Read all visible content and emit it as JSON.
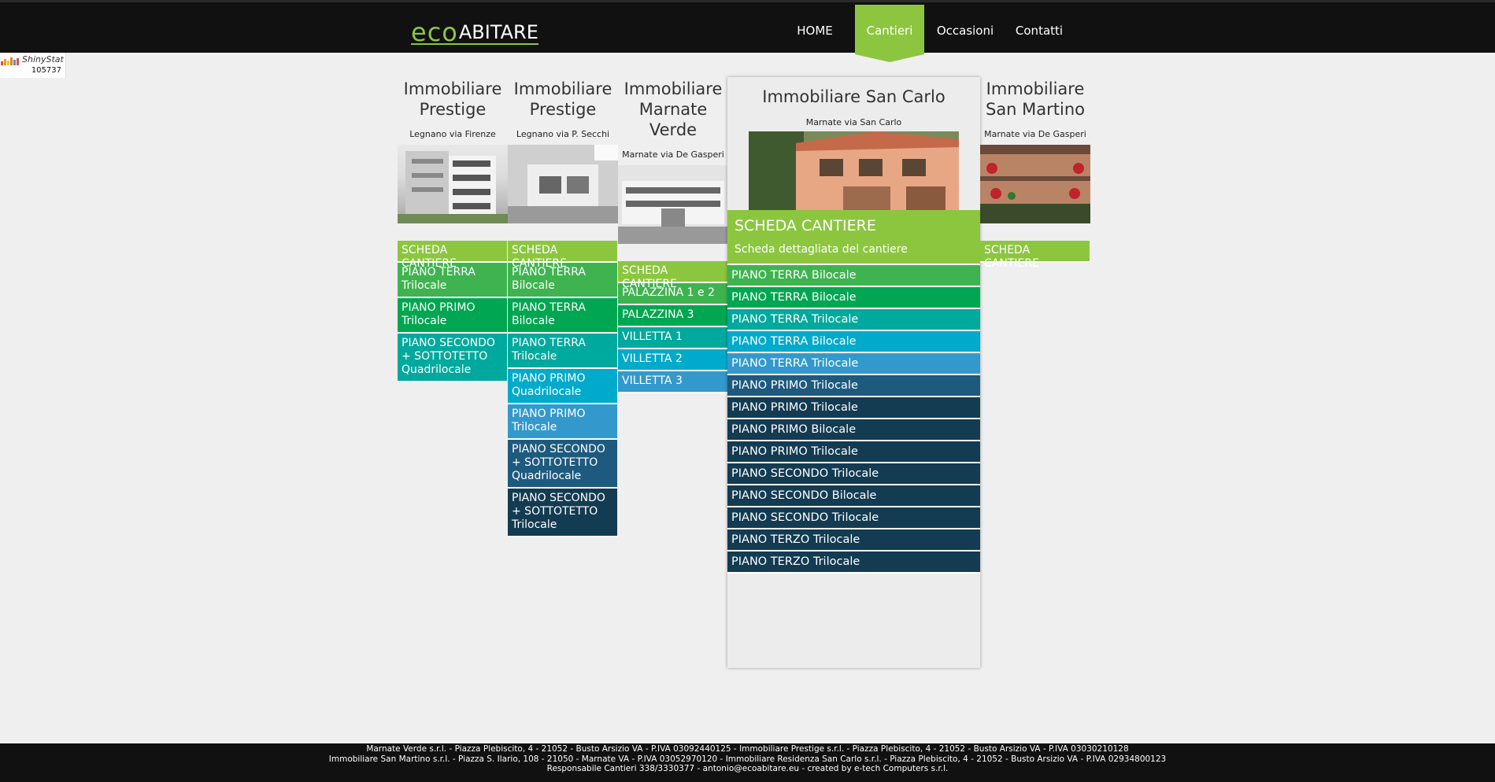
{
  "header": {
    "logo_eco": "eco",
    "logo_rest": "ABITARE",
    "nav": [
      "HOME",
      "Cantieri",
      "Occasioni",
      "Contatti"
    ],
    "active_nav": "Cantieri"
  },
  "counter": {
    "brand": "ShinyStat",
    "count": "105737"
  },
  "columns": [
    {
      "title": "Immobiliare Prestige",
      "subtitle": "Legnano via Firenze",
      "items": [
        "SCHEDA CANTIERE",
        "PIANO TERRA Trilocale",
        "PIANO PRIMO Trilocale",
        "PIANO SECONDO + SOTTOTETTO Quadrilocale"
      ]
    },
    {
      "title": "Immobiliare Prestige",
      "subtitle": "Legnano via P. Secchi",
      "items": [
        "SCHEDA CANTIERE",
        "PIANO TERRA Bilocale",
        "PIANO TERRA Bilocale",
        "PIANO TERRA Trilocale",
        "PIANO PRIMO Quadrilocale",
        "PIANO PRIMO Trilocale",
        "PIANO SECONDO + SOTTOTETTO Quadrilocale",
        "PIANO SECONDO + SOTTOTETTO Trilocale"
      ]
    },
    {
      "title": "Immobiliare Marnate Verde",
      "subtitle": "Marnate via De Gasperi",
      "items": [
        "SCHEDA CANTIERE",
        "PALAZZINA 1 e 2",
        "PALAZZINA 3",
        "VILLETTA 1",
        "VILLETTA 2",
        "VILLETTA 3"
      ]
    },
    {
      "title": "Immobiliare San Martino",
      "subtitle": "Marnate via De Gasperi",
      "items": [
        "SCHEDA CANTIERE"
      ]
    }
  ],
  "panel": {
    "title": "Immobiliare San Carlo",
    "subtitle": "Marnate via San Carlo",
    "scheda_title": "SCHEDA CANTIERE",
    "scheda_sub": "Scheda dettagliata del cantiere",
    "items": [
      "PIANO TERRA Bilocale",
      "PIANO TERRA Bilocale",
      "PIANO TERRA Trilocale",
      "PIANO TERRA Bilocale",
      "PIANO TERRA Trilocale",
      "PIANO PRIMO Trilocale",
      "PIANO PRIMO Trilocale",
      "PIANO PRIMO Bilocale",
      "PIANO PRIMO Trilocale",
      "PIANO SECONDO Trilocale",
      "PIANO SECONDO Bilocale",
      "PIANO SECONDO Trilocale",
      "PIANO TERZO Trilocale",
      "PIANO TERZO Trilocale"
    ]
  },
  "palette": [
    "#8cc63f",
    "#3fb34f",
    "#00a651",
    "#00a99d",
    "#00aacb",
    "#3399cc",
    "#1d5a7e",
    "#133b52"
  ],
  "footer": {
    "line1": "Marnate Verde s.r.l. - Piazza Plebiscito, 4 - 21052 - Busto Arsizio VA - P.IVA 03092440125 - Immobiliare Prestige s.r.l. - Piazza Plebiscito, 4 - 21052 - Busto Arsizio VA - P.IVA 03030210128",
    "line2": "Immobiliare San Martino s.r.l. - Piazza S. Ilario, 108 - 21050 - Marnate VA - P.IVA 03052970120 - Immobiliare Residenza San Carlo s.r.l. - Piazza Plebiscito, 4 - 21052 - Busto Arsizio VA - P.IVA 02934800123",
    "line3": "Responsabile Cantieri 338/3330377 - antonio@ecoabitare.eu - created by e-tech Computers s.r.l."
  }
}
